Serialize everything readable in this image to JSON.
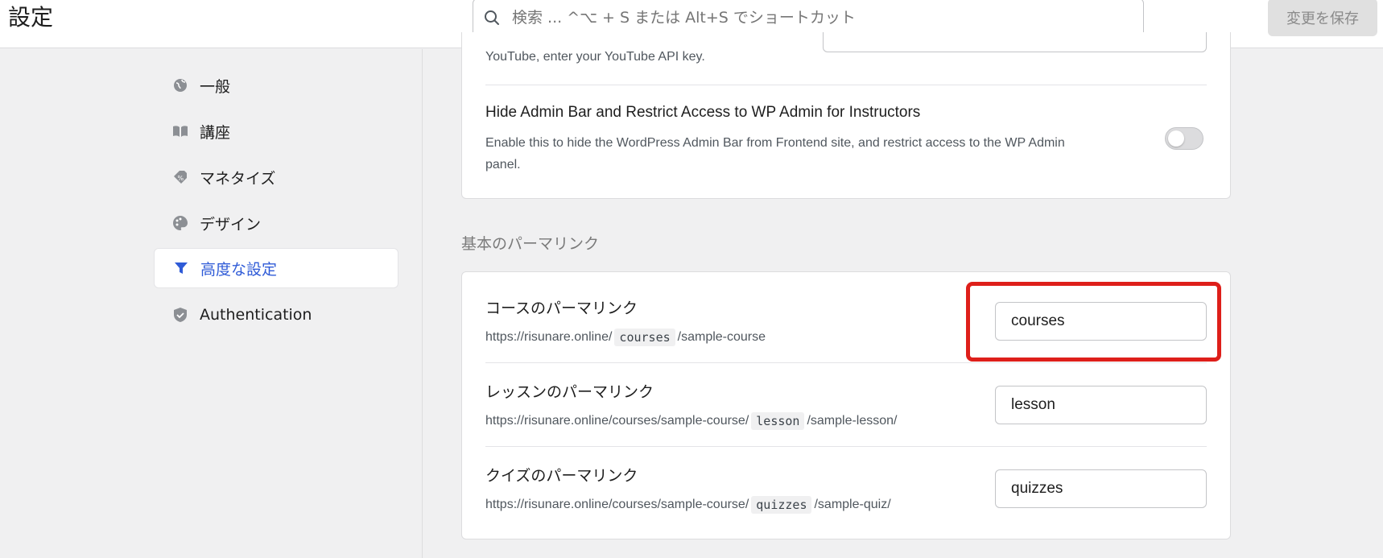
{
  "header": {
    "title": "設定",
    "search_placeholder": "検索 ... ^⌥ + S または Alt+S でショートカット",
    "save_label": "変更を保存"
  },
  "sidebar": {
    "items": [
      {
        "label": "一般",
        "icon": "globe-icon"
      },
      {
        "label": "講座",
        "icon": "book-icon"
      },
      {
        "label": "マネタイズ",
        "icon": "tag-icon"
      },
      {
        "label": "デザイン",
        "icon": "palette-icon"
      },
      {
        "label": "高度な設定",
        "icon": "filter-icon",
        "active": true
      },
      {
        "label": "Authentication",
        "icon": "shield-icon"
      }
    ]
  },
  "main": {
    "youtube_desc": "YouTube, enter your YouTube API key.",
    "admin_bar": {
      "title": "Hide Admin Bar and Restrict Access to WP Admin for Instructors",
      "desc_line1": "Enable this to hide the WordPress Admin Bar from Frontend site, and restrict access to the WP Admin",
      "desc_line2": "panel.",
      "enabled": false
    },
    "permalink_section": "基本のパーマリンク",
    "permalinks": [
      {
        "title": "コースのパーマリンク",
        "url_prefix": "https://risunare.online/",
        "slug": "courses",
        "url_suffix": "/sample-course",
        "value": "courses"
      },
      {
        "title": "レッスンのパーマリンク",
        "url_prefix": "https://risunare.online/courses/sample-course/",
        "slug": "lesson",
        "url_suffix": "/sample-lesson/",
        "value": "lesson"
      },
      {
        "title": "クイズのパーマリンク",
        "url_prefix": "https://risunare.online/courses/sample-course/",
        "slug": "quizzes",
        "url_suffix": "/sample-quiz/",
        "value": "quizzes"
      }
    ]
  },
  "colors": {
    "accent": "#2f5bd7",
    "highlight": "#de1f1a",
    "background": "#f0f0f1"
  }
}
